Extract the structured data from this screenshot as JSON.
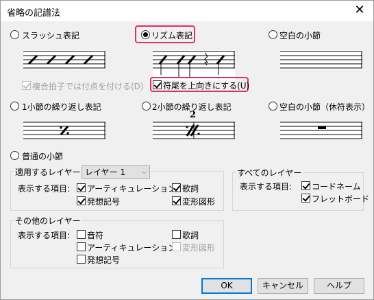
{
  "window": {
    "title": "省略の記譜法"
  },
  "options": {
    "slash": "スラッシュ表記",
    "rhythm": "リズム表記",
    "blank_measure": "空白の小節",
    "composite_dot": "複合拍子では付点を付ける(D)",
    "stems_up": "符尾を上向きにする(U)",
    "one_bar_repeat": "1小節の繰り返し表記",
    "two_bar_repeat": "2小節の繰り返し表記",
    "blank_rest": "空白の小節（休符表示）",
    "normal": "普通の小節",
    "two_bar_number": "2"
  },
  "layer_group": {
    "apply_label": "適用するレイヤー:",
    "layer_value": "レイヤー 1",
    "show_label": "表示する項目:",
    "items": [
      "アーティキュレーション",
      "発想記号",
      "歌詞",
      "変形図形"
    ]
  },
  "all_layers": {
    "title": "すべてのレイヤー",
    "show_label": "表示する項目:",
    "items": [
      "コードネーム",
      "フレットボード"
    ]
  },
  "other_layers": {
    "title": "その他のレイヤー",
    "show_label": "表示する項目:",
    "items": [
      "音符",
      "アーティキュレーション",
      "発想記号",
      "歌詞",
      "変形図形"
    ]
  },
  "buttons": {
    "ok": "OK",
    "cancel": "キャンセル",
    "help": "ヘルプ"
  },
  "colors": {
    "highlight": "#e0305c",
    "default_button": "#0078d7"
  }
}
